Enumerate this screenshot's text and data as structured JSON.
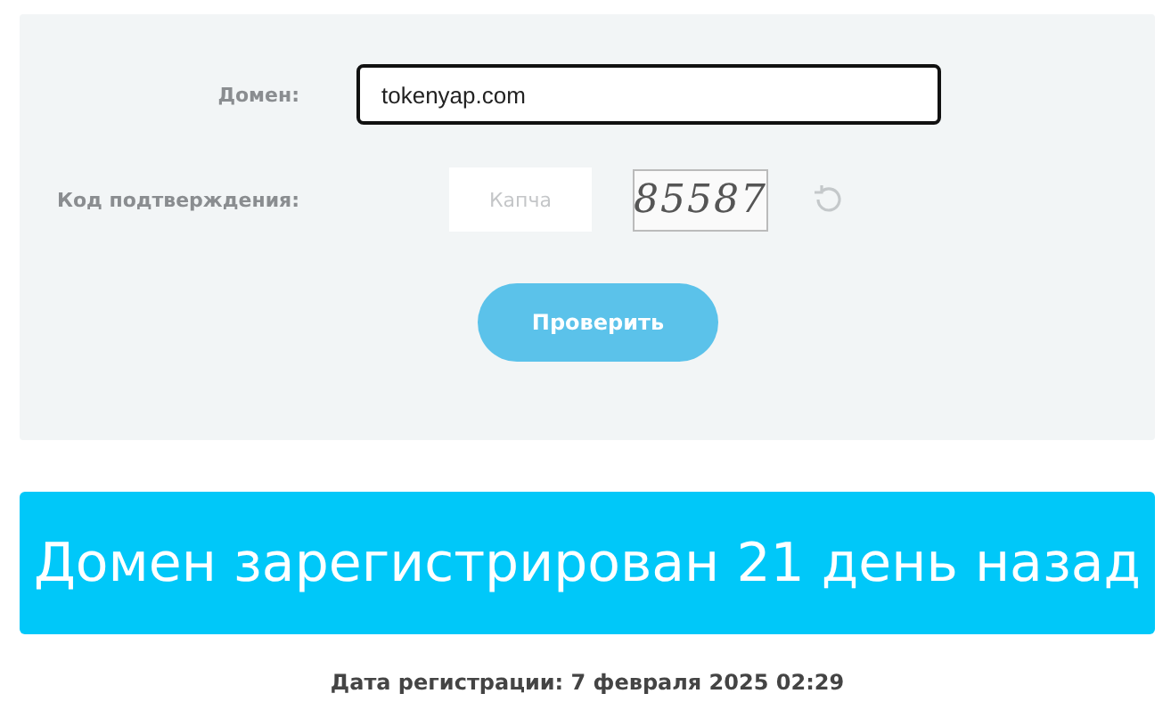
{
  "form": {
    "domain_label": "Домен:",
    "domain_value": "tokenyap.com",
    "domain_focused": true,
    "code_label": "Код подтверждения:",
    "captcha_placeholder": "Капча",
    "captcha_text": "85587",
    "button": "Проверить"
  },
  "result": {
    "banner": "Домен зарегистрирован 21 день назад",
    "date_line": "Дата регистрации: 7 февраля 2025 02:29"
  }
}
